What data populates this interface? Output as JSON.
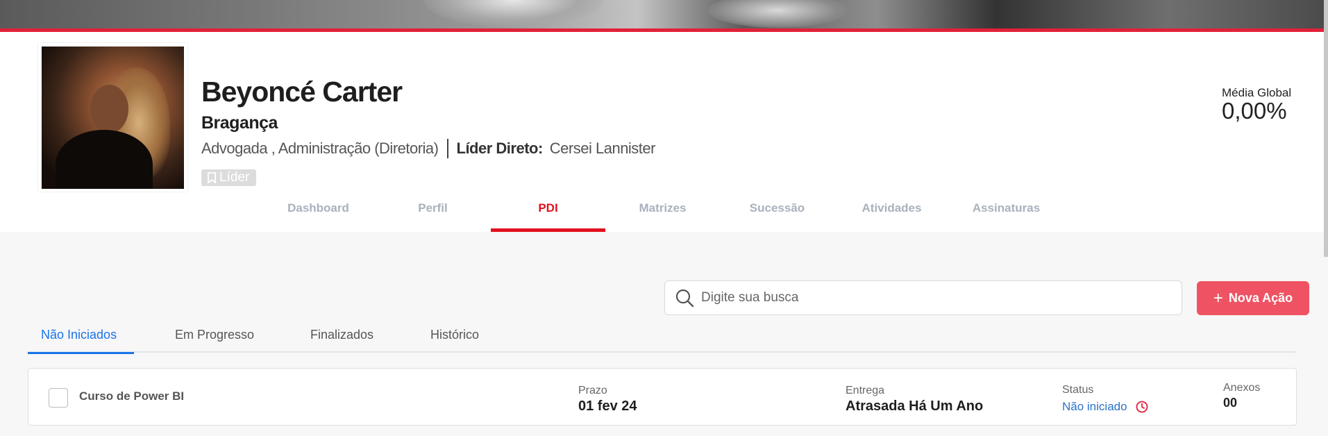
{
  "profile": {
    "name": "Beyoncé Carter",
    "city": "Bragança",
    "role": "Advogada , Administração (Diretoria)",
    "lead_label": "Líder Direto:",
    "lead_name": "Cersei Lannister",
    "badge": "Líder"
  },
  "media": {
    "label": "Média Global",
    "value": "0,00%"
  },
  "tabs": [
    {
      "label": "Dashboard",
      "active": false
    },
    {
      "label": "Perfil",
      "active": false
    },
    {
      "label": "PDI",
      "active": true
    },
    {
      "label": "Matrizes",
      "active": false
    },
    {
      "label": "Sucessão",
      "active": false
    },
    {
      "label": "Atividades",
      "active": false
    },
    {
      "label": "Assinaturas",
      "active": false
    }
  ],
  "search": {
    "placeholder": "Digite sua busca"
  },
  "actions": {
    "new_action": "Nova Ação"
  },
  "subtabs": [
    {
      "label": "Não Iniciados",
      "active": true
    },
    {
      "label": "Em Progresso",
      "active": false
    },
    {
      "label": "Finalizados",
      "active": false
    },
    {
      "label": "Histórico",
      "active": false
    }
  ],
  "items": [
    {
      "title": "Curso de Power BI",
      "deadline_label": "Prazo",
      "deadline": "01 fev 24",
      "delivery_label": "Entrega",
      "delivery": "Atrasada Há Um Ano",
      "status_label": "Status",
      "status": "Não iniciado",
      "attachments_label": "Anexos",
      "attachments": "00"
    }
  ],
  "colors": {
    "accent": "#e2101e",
    "button": "#ef5363",
    "link": "#1a73e8",
    "status": "#2a72c8"
  },
  "icons": {
    "badge": "bookmark-icon",
    "search": "search-icon",
    "add": "plus-icon",
    "status": "clock-icon"
  }
}
